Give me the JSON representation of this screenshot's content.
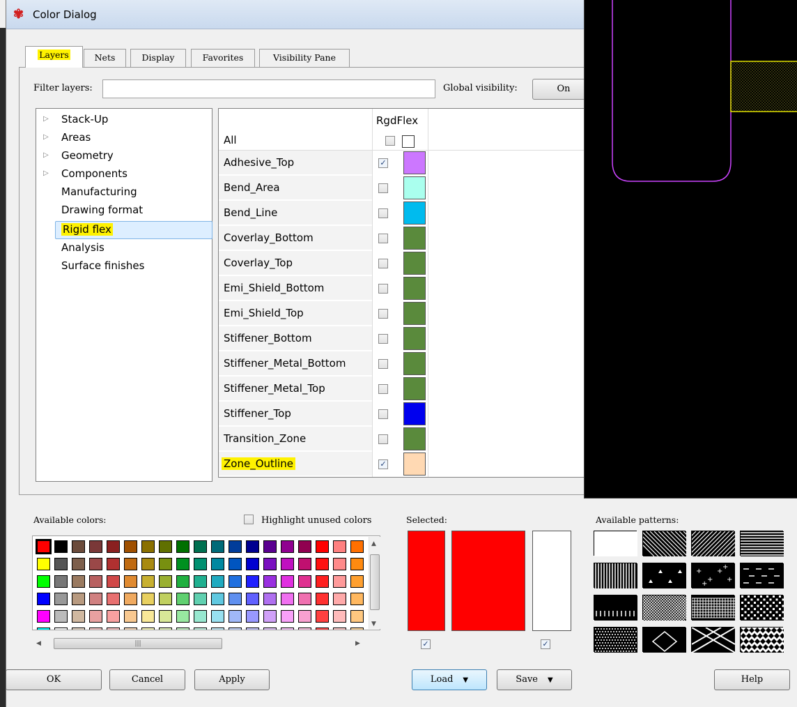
{
  "window": {
    "title": "Color Dialog"
  },
  "tabs": [
    {
      "label": "Layers",
      "active": true,
      "highlighted": true
    },
    {
      "label": "Nets"
    },
    {
      "label": "Display"
    },
    {
      "label": "Favorites"
    },
    {
      "label": "Visibility Pane"
    }
  ],
  "filter": {
    "label": "Filter layers:",
    "value": ""
  },
  "global_visibility": {
    "label": "Global visibility:",
    "button": "On"
  },
  "tree": {
    "items": [
      {
        "label": "Stack-Up",
        "expandable": true
      },
      {
        "label": "Areas",
        "expandable": true
      },
      {
        "label": "Geometry",
        "expandable": true
      },
      {
        "label": "Components",
        "expandable": true
      },
      {
        "label": "Manufacturing"
      },
      {
        "label": "Drawing format"
      },
      {
        "label": "Rigid flex",
        "selected": true
      },
      {
        "label": "Analysis"
      },
      {
        "label": "Surface finishes"
      }
    ]
  },
  "grid": {
    "all_label": "All",
    "column_label": "RgdFlex",
    "rows": [
      {
        "name": "Adhesive_Top",
        "checked": true,
        "color": "#cc77ff"
      },
      {
        "name": "Bend_Area",
        "checked": false,
        "color": "#aaffee"
      },
      {
        "name": "Bend_Line",
        "checked": false,
        "color": "#00bbee"
      },
      {
        "name": "Coverlay_Bottom",
        "checked": false,
        "color": "#5a8a3c"
      },
      {
        "name": "Coverlay_Top",
        "checked": false,
        "color": "#5a8a3c"
      },
      {
        "name": "Emi_Shield_Bottom",
        "checked": false,
        "color": "#5a8a3c"
      },
      {
        "name": "Emi_Shield_Top",
        "checked": false,
        "color": "#5a8a3c"
      },
      {
        "name": "Stiffener_Bottom",
        "checked": false,
        "color": "#5a8a3c"
      },
      {
        "name": "Stiffener_Metal_Bottom",
        "checked": false,
        "color": "#5a8a3c"
      },
      {
        "name": "Stiffener_Metal_Top",
        "checked": false,
        "color": "#5a8a3c"
      },
      {
        "name": "Stiffener_Top",
        "checked": false,
        "color": "#0000ee"
      },
      {
        "name": "Transition_Zone",
        "checked": false,
        "color": "#5a8a3c"
      },
      {
        "name": "Zone_Outline",
        "checked": true,
        "color": "#ffd9b3",
        "highlighted": true
      }
    ]
  },
  "available_colors": {
    "label": "Available colors:",
    "highlight_label": "Highlight unused colors",
    "highlight_checked": false,
    "rows": [
      [
        "#ff0000",
        "#000000",
        "#6b4b3b",
        "#7a3838",
        "#8a2020",
        "#a05000",
        "#8a7000",
        "#607000",
        "#007000",
        "#007050",
        "#006a78",
        "#003c9a",
        "#000090",
        "#5a0090",
        "#900090",
        "#900050",
        "#ff0000",
        "#ff8080",
        "#ff7000"
      ],
      [
        "#ffff00",
        "#555555",
        "#7d5e4b",
        "#9a4848",
        "#b03030",
        "#c06a10",
        "#a88a10",
        "#789010",
        "#009020",
        "#009070",
        "#0088a0",
        "#0055c0",
        "#0000d0",
        "#7a10c0",
        "#c010c0",
        "#c01070",
        "#ff1010",
        "#ff8a8a",
        "#ff8a10"
      ],
      [
        "#00ff00",
        "#777777",
        "#9a7a60",
        "#b86060",
        "#d04848",
        "#e08a30",
        "#c8b030",
        "#9ab030",
        "#20b040",
        "#20b090",
        "#20aac0",
        "#2070e0",
        "#2020ff",
        "#9a30e0",
        "#e030e0",
        "#e03090",
        "#ff2020",
        "#ff9a9a",
        "#ffa030"
      ],
      [
        "#0000ff",
        "#999999",
        "#b89a80",
        "#d08080",
        "#e87070",
        "#f0aa60",
        "#e8d060",
        "#c0d060",
        "#60d070",
        "#60d0b0",
        "#60c8e0",
        "#6090f0",
        "#6060ff",
        "#b070f0",
        "#f070f0",
        "#f070b0",
        "#ff3030",
        "#ffaaaa",
        "#ffb860"
      ],
      [
        "#ff00ff",
        "#bbbbbb",
        "#d0b8a0",
        "#e8a0a0",
        "#f8a0a0",
        "#f8c890",
        "#f8e898",
        "#d8e898",
        "#98e8a0",
        "#98e8d0",
        "#98e0f0",
        "#a0b8f8",
        "#9898ff",
        "#d0a0f8",
        "#f8a0f8",
        "#f8a0d0",
        "#ff4040",
        "#ffbbbb",
        "#ffc880"
      ],
      [
        "#00ffff",
        "#ffffff",
        "#e8d8c8",
        "#f8c8c8",
        "#ffc8c8",
        "#ffe0c0",
        "#ffffc0",
        "#e8f8c0",
        "#c8f8c8",
        "#c8f8e8",
        "#c8f0ff",
        "#c8d8ff",
        "#c8c8ff",
        "#e8c8ff",
        "#ffc8ff",
        "#ffc8e8",
        "#ff5050",
        "#ffcccc",
        "#ffd8a0"
      ]
    ]
  },
  "selected": {
    "label": "Selected:",
    "foreground": "#ff0000",
    "main": "#ff0000",
    "background": "#ffffff",
    "check_left": true,
    "check_right": true
  },
  "patterns": {
    "label": "Available patterns:",
    "items": [
      "solid-white",
      "diag-back-lines",
      "diag-fwd-lines",
      "horizontal-lines",
      "vertical-lines",
      "triangles",
      "plus-dots",
      "dashes",
      "vertical-dashes",
      "cross-hatch",
      "grid",
      "checker",
      "dense-dots",
      "diamond",
      "big-x",
      "diamond-grid"
    ]
  },
  "buttons": {
    "ok": "OK",
    "cancel": "Cancel",
    "apply": "Apply",
    "load": "Load",
    "save": "Save",
    "help": "Help"
  },
  "canvas": {
    "outline_color": "#cc44ff",
    "flex_color": "#e0e000"
  }
}
